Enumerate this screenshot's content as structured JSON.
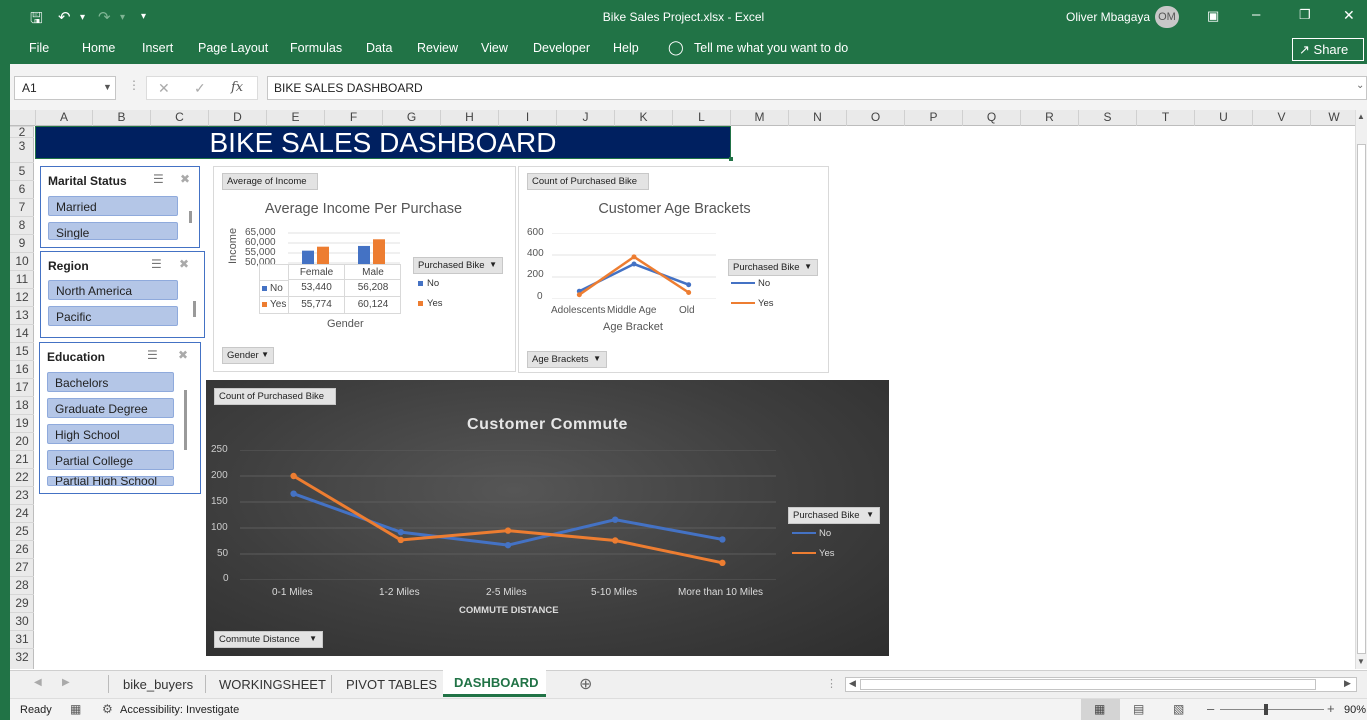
{
  "window": {
    "title": "Bike Sales Project.xlsx  -  Excel",
    "user": "Oliver Mbagaya",
    "user_initials": "OM",
    "share": "Share"
  },
  "ribbon": {
    "tabs": [
      "File",
      "Home",
      "Insert",
      "Page Layout",
      "Formulas",
      "Data",
      "Review",
      "View",
      "Developer",
      "Help"
    ],
    "tell_me": "Tell me what you want to do"
  },
  "formula_bar": {
    "cell": "A1",
    "content": "BIKE SALES DASHBOARD"
  },
  "columns": [
    "A",
    "B",
    "C",
    "D",
    "E",
    "F",
    "G",
    "H",
    "I",
    "J",
    "K",
    "L",
    "M",
    "N",
    "O",
    "P",
    "Q",
    "R",
    "S",
    "T",
    "U",
    "V",
    "W"
  ],
  "rows": [
    "2",
    "3",
    "5",
    "6",
    "7",
    "8",
    "9",
    "10",
    "11",
    "12",
    "13",
    "14",
    "15",
    "16",
    "17",
    "18",
    "19",
    "20",
    "21",
    "22",
    "23",
    "24",
    "25",
    "26",
    "27",
    "28",
    "29",
    "30",
    "31",
    "32"
  ],
  "dashboard_title": "BIKE SALES DASHBOARD",
  "slicers": {
    "marital": {
      "title": "Marital Status",
      "items": [
        "Married",
        "Single"
      ]
    },
    "region": {
      "title": "Region",
      "items": [
        "North America",
        "Pacific"
      ]
    },
    "education": {
      "title": "Education",
      "items": [
        "Bachelors",
        "Graduate Degree",
        "High School",
        "Partial College",
        "Partial High School"
      ]
    }
  },
  "income_chart": {
    "field_button": "Average of Income",
    "axis_button": "Gender",
    "legend_button": "Purchased Bike",
    "title": "Average Income Per Purchase",
    "ylabel": "Income",
    "xlabel": "Gender",
    "yticks": [
      "65,000",
      "60,000",
      "55,000",
      "50,000"
    ],
    "categories": [
      "Female",
      "Male"
    ],
    "series": [
      {
        "name": "No",
        "values_text": [
          "53,440",
          "56,208"
        ]
      },
      {
        "name": "Yes",
        "values_text": [
          "55,774",
          "60,124"
        ]
      }
    ]
  },
  "age_chart": {
    "field_button": "Count of Purchased Bike",
    "axis_button": "Age Brackets",
    "legend_button": "Purchased Bike",
    "title": "Customer Age Brackets",
    "xlabel": "Age Bracket",
    "categories": [
      "Adolescents",
      "Middle Age",
      "Old"
    ],
    "yticks": [
      "600",
      "400",
      "200",
      "0"
    ],
    "legend": [
      "No",
      "Yes"
    ]
  },
  "commute_chart": {
    "field_button": "Count of Purchased Bike",
    "axis_button": "Commute Distance",
    "legend_button": "Purchased Bike",
    "title": "Customer Commute",
    "xlabel": "COMMUTE DISTANCE",
    "categories": [
      "0-1 Miles",
      "1-2 Miles",
      "2-5 Miles",
      "5-10 Miles",
      "More than 10 Miles"
    ],
    "yticks": [
      "250",
      "200",
      "150",
      "100",
      "50",
      "0"
    ],
    "legend": [
      "No",
      "Yes"
    ]
  },
  "chart_data": [
    {
      "type": "bar",
      "title": "Average Income Per Purchase",
      "xlabel": "Gender",
      "ylabel": "Income",
      "categories": [
        "Female",
        "Male"
      ],
      "ylim": [
        45000,
        65000
      ],
      "series": [
        {
          "name": "No",
          "values": [
            53440,
            56208
          ]
        },
        {
          "name": "Yes",
          "values": [
            55774,
            60124
          ]
        }
      ]
    },
    {
      "type": "line",
      "title": "Customer Age Brackets",
      "xlabel": "Age Bracket",
      "categories": [
        "Adolescents",
        "Middle Age",
        "Old"
      ],
      "ylim": [
        0,
        600
      ],
      "series": [
        {
          "name": "No",
          "values": [
            71,
            318,
            130
          ]
        },
        {
          "name": "Yes",
          "values": [
            39,
            383,
            59
          ]
        }
      ]
    },
    {
      "type": "line",
      "title": "Customer Commute",
      "xlabel": "COMMUTE DISTANCE",
      "categories": [
        "0-1 Miles",
        "1-2 Miles",
        "2-5 Miles",
        "5-10 Miles",
        "More than 10 Miles"
      ],
      "ylim": [
        0,
        250
      ],
      "series": [
        {
          "name": "No",
          "values": [
            166,
            92,
            67,
            116,
            78
          ]
        },
        {
          "name": "Yes",
          "values": [
            200,
            77,
            95,
            76,
            33
          ]
        }
      ]
    }
  ],
  "colors": {
    "ribbon": "#217346",
    "banner": "#002060",
    "no": "#4472c4",
    "yes": "#ed7d31"
  },
  "sheet_tabs": [
    "bike_buyers",
    "WORKINGSHEET",
    "PIVOT TABLES",
    "DASHBOARD"
  ],
  "active_tab": "DASHBOARD",
  "status": {
    "ready": "Ready",
    "accessibility": "Accessibility: Investigate",
    "zoom": "90%"
  }
}
